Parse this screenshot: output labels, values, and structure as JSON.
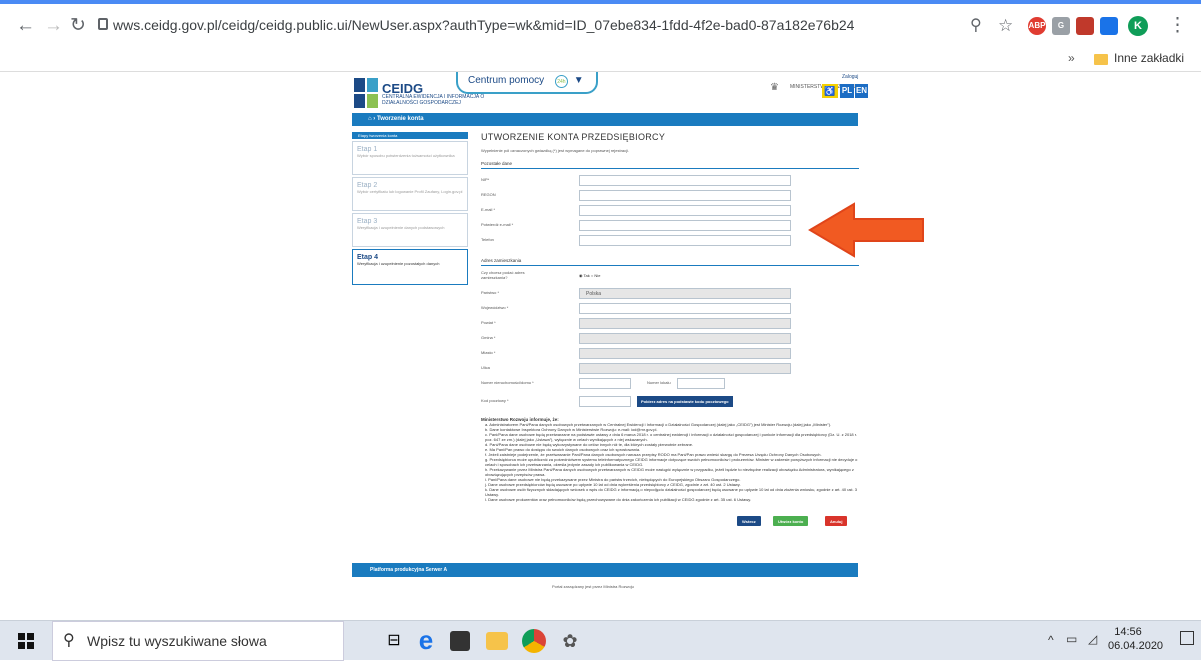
{
  "browser": {
    "url": "wws.ceidg.gov.pl/ceidg/ceidg.public.ui/NewUser.aspx?authType=wk&mid=ID_07ebe834-1fdd-4f2e-bad0-87a182e76b24",
    "extensions": [
      "ABP",
      "G"
    ],
    "profile_initial": "K",
    "bookmarks_more": "»",
    "bookmark_folder": "Inne zakładki"
  },
  "header": {
    "logo_text": "CEIDG",
    "logo_subtitle": "CENTRALNA EWIDENCJA I INFORMACJA O DZIAŁALNOŚCI GOSPODARCZEJ",
    "help_label": "Centrum pomocy",
    "ministry": "MINISTERSTWO ROZWOJU",
    "login": "Zaloguj",
    "lang_pl": "PL",
    "lang_en": "EN"
  },
  "nav_bar": {
    "title": "Tworzenie konta"
  },
  "sidebar": {
    "title": "Etapy tworzenia konta",
    "steps": [
      {
        "heading": "Etap 1",
        "desc": "Wybór sposobu potwierdzenia tożsamości użytkownika"
      },
      {
        "heading": "Etap 2",
        "desc": "Wybór certyfikatu lub logowanie Profil Zaufany, Login.gov.pl"
      },
      {
        "heading": "Etap 3",
        "desc": "Weryfikacja i uzupełnienie danych podstawowych"
      },
      {
        "heading": "Etap 4",
        "desc": "Weryfikacja i uzupełnienie pozostałych danych"
      }
    ]
  },
  "form": {
    "title": "UTWORZENIE KONTA PRZEDSIĘBIORCY",
    "intro": "Wypełnienie pól oznaczonych gwiazdką (*) jest wymagane do poprawnej rejestracji.",
    "section_other": "Pozostałe dane",
    "nip": "NIP*",
    "regon": "REGON",
    "email": "E-mail *",
    "email_confirm": "Potwierdź e-mail *",
    "phone": "Telefon",
    "section_address": "Adres zamieszkania",
    "address_question": "Czy chcesz podać adres zamieszkania?",
    "radio_yes": "Tak",
    "radio_no": "Nie",
    "country": "Państwo *",
    "country_value": "Polska",
    "voivodeship": "Województwo *",
    "district": "Powiat *",
    "commune": "Gmina *",
    "city": "Miasto *",
    "street": "Ulica",
    "house_no": "Numer nieruchomości/domu *",
    "flat_no": "Numer lokalu",
    "postal": "Kod pocztowy *",
    "postal_btn": "Pobierz adres na podstawie kodu pocztowego"
  },
  "notice": {
    "heading": "Ministerstwo Rozwoju informuje, że:",
    "items": [
      "a. Administratorem Pani/Pana danych osobowych przetwarzanych w Centralnej Ewidencji i Informacji o Działalności Gospodarczej (dalej jako „CEIDG”) jest Minister Rozwoju (dalej jako „Minister”).",
      "b. Dane kontaktowe Inspektora Ochrony Danych w Ministerstwie Rozwoju: e-mail: iod@mr.gov.pl.",
      "c. Pani/Pana dane osobowe będą przetwarzane na podstawie ustawy z dnia 6 marca 2018 r. o centralnej ewidencji i informacji o działalności gospodarczej i punkcie informacji dla przedsiębiorcy (Dz. U. z 2018 r. poz. 647 ze zm.) (dalej jako „Ustawa”), wyłącznie w celach wynikających z niej wskazanych.",
      "d. Pani/Pana dane osobowe nie będą wykorzystywane do celów innych niż te, dla których zostały pierwotnie zebrane.",
      "e. Ma Pani/Pan prawo do dostępu do swoich danych osobowych oraz ich sprostowania.",
      "f. Jeżeli zaistnieje podejrzenie, że przetwarzanie Pani/Pana danych osobowych narusza przepisy RODO ma Pani/Pan prawo wnieść skargę do Prezesa Urzędu Ochrony Danych Osobowych.",
      "g. Przedsiębiorca może upublicznić za pośrednictwem systemu teleinformatycznego CEIDG informacje dotyczące swoich pełnomocników i prokurentów. Minister w zakresie powyższych informacji nie decyduje o celach i sposobach ich przetwarzania, określa jedynie zasady ich publikowania w CEIDG.",
      "h. Przekazywanie przez Ministra Pani/Pana danych osobowych przetwarzanych w CEIDG może nastąpić wyłącznie w przypadku, jeżeli będzie to niezbędne realizacji obowiązku Administratora, wynikającego z obowiązujących przepisów prawa.",
      "i. Pani/Pana dane osobowe nie będą przekazywane przez Ministra do państw trzecich, niebędących do Europejskiego Obszaru Gospodarczego.",
      "j. Dane osobowe przedsiębiorców będą usuwane po upływie 10 lat od dnia wykreślenia przedsiębiorcy z CEIDG, zgodnie z art. 40 ust. 2 Ustawy.",
      "k. Dane osobowe osób fizycznych składających wniosek o wpis do CEIDG z informacją o niepodjęciu działalności gospodarczej będą usuwane po upływie 10 lat od dnia złożenia wniosku, zgodnie z art. 40 ust. 3 Ustawy.",
      "l. Dane osobowe prokurentów oraz pełnomocników będą przechowywane do dnia zakończenia ich publikacji w CEIDG zgodnie z art. 35 ust. 6 Ustawy."
    ]
  },
  "actions": {
    "back": "Wstecz",
    "create": "Utwórz konto",
    "cancel": "Anuluj"
  },
  "footer": {
    "platform": "Platforma produkcyjna Serwer A",
    "maintained": "Portal zarządzany jest przez Ministra Rozwoju"
  },
  "taskbar": {
    "search_placeholder": "Wpisz tu wyszukiwane słowa",
    "time": "14:56",
    "date": "06.04.2020"
  },
  "colors": {
    "accent": "#1a7bbf",
    "arrow": "#f15a22",
    "browser_top": "#4a8af4"
  }
}
